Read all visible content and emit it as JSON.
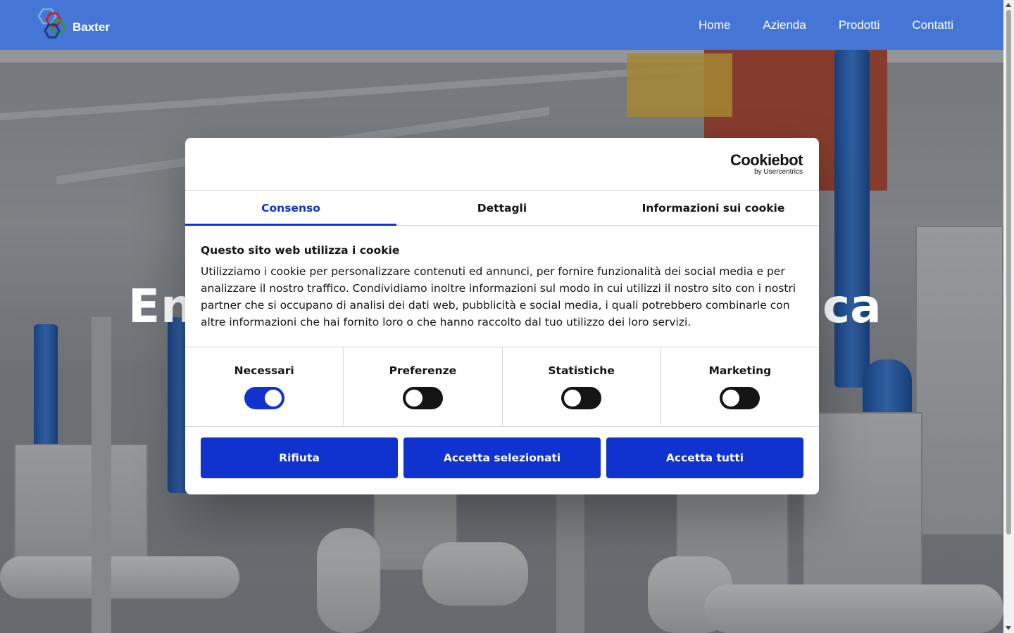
{
  "header": {
    "brand": "Baxter",
    "nav": [
      "Home",
      "Azienda",
      "Prodotti",
      "Contatti"
    ]
  },
  "hero": {
    "title_left": "En",
    "title_right": "ca"
  },
  "cookie_dialog": {
    "logo": {
      "brand": "Cookiebot",
      "sub": "by Usercentrics"
    },
    "tabs": [
      "Consenso",
      "Dettagli",
      "Informazioni sui cookie"
    ],
    "active_tab": "Consenso",
    "heading": "Questo sito web utilizza i cookie",
    "text": "Utilizziamo i cookie per personalizzare contenuti ed annunci, per fornire funzionalità dei social media e per analizzare il nostro traffico. Condividiamo inoltre informazioni sul modo in cui utilizzi il nostro sito con i nostri partner che si occupano di analisi dei dati web, pubblicità e social media, i quali potrebbero combinarle con altre informazioni che hai fornito loro o che hanno raccolto dal tuo utilizzo dei loro servizi.",
    "categories": [
      {
        "label": "Necessari",
        "enabled": true
      },
      {
        "label": "Preferenze",
        "enabled": false
      },
      {
        "label": "Statistiche",
        "enabled": false
      },
      {
        "label": "Marketing",
        "enabled": false
      }
    ],
    "buttons": {
      "reject": "Rifiuta",
      "accept_selected": "Accetta selezionati",
      "accept_all": "Accetta tutti"
    }
  },
  "colors": {
    "header_bg": "#4576d6",
    "accent": "#1032cf"
  }
}
